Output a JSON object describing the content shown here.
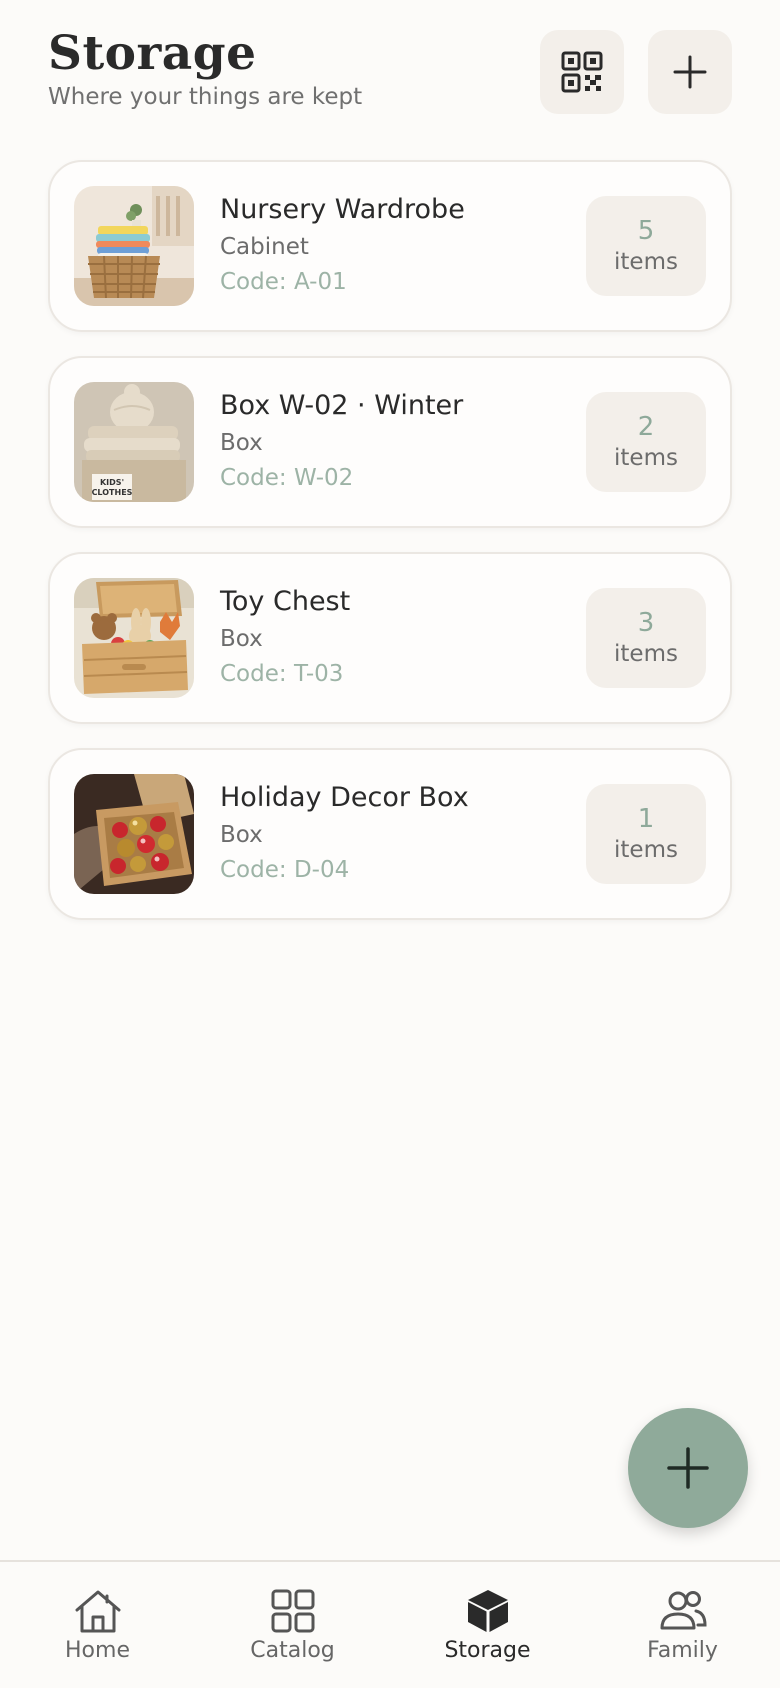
{
  "header": {
    "title": "Storage",
    "subtitle": "Where your things are kept",
    "qr_icon": "qr-code-icon",
    "add_icon": "plus-icon"
  },
  "storage": [
    {
      "name": "Nursery Wardrobe",
      "kind": "Cabinet",
      "code": "Code: A-01",
      "count": "5",
      "unit": "items",
      "image": "folded-clothes-basket"
    },
    {
      "name": "Box W-02 · Winter",
      "kind": "Box",
      "code": "Code: W-02",
      "count": "2",
      "unit": "items",
      "image": "knitwear-box",
      "image_label_line1": "KIDS'",
      "image_label_line2": "CLOTHES"
    },
    {
      "name": "Toy Chest",
      "kind": "Box",
      "code": "Code: T-03",
      "count": "3",
      "unit": "items",
      "image": "toy-chest"
    },
    {
      "name": "Holiday Decor Box",
      "kind": "Box",
      "code": "Code: D-04",
      "count": "1",
      "unit": "items",
      "image": "ornament-box"
    }
  ],
  "fab": {
    "icon": "plus-icon"
  },
  "nav": [
    {
      "label": "Home",
      "icon": "home-icon"
    },
    {
      "label": "Catalog",
      "icon": "grid-icon"
    },
    {
      "label": "Storage",
      "icon": "box-icon",
      "active": true
    },
    {
      "label": "Family",
      "icon": "people-icon"
    }
  ],
  "colors": {
    "background": "#fcfbf9",
    "accent": "#8faa9a",
    "code_text": "#9db3a6",
    "chip": "#f3efea"
  }
}
